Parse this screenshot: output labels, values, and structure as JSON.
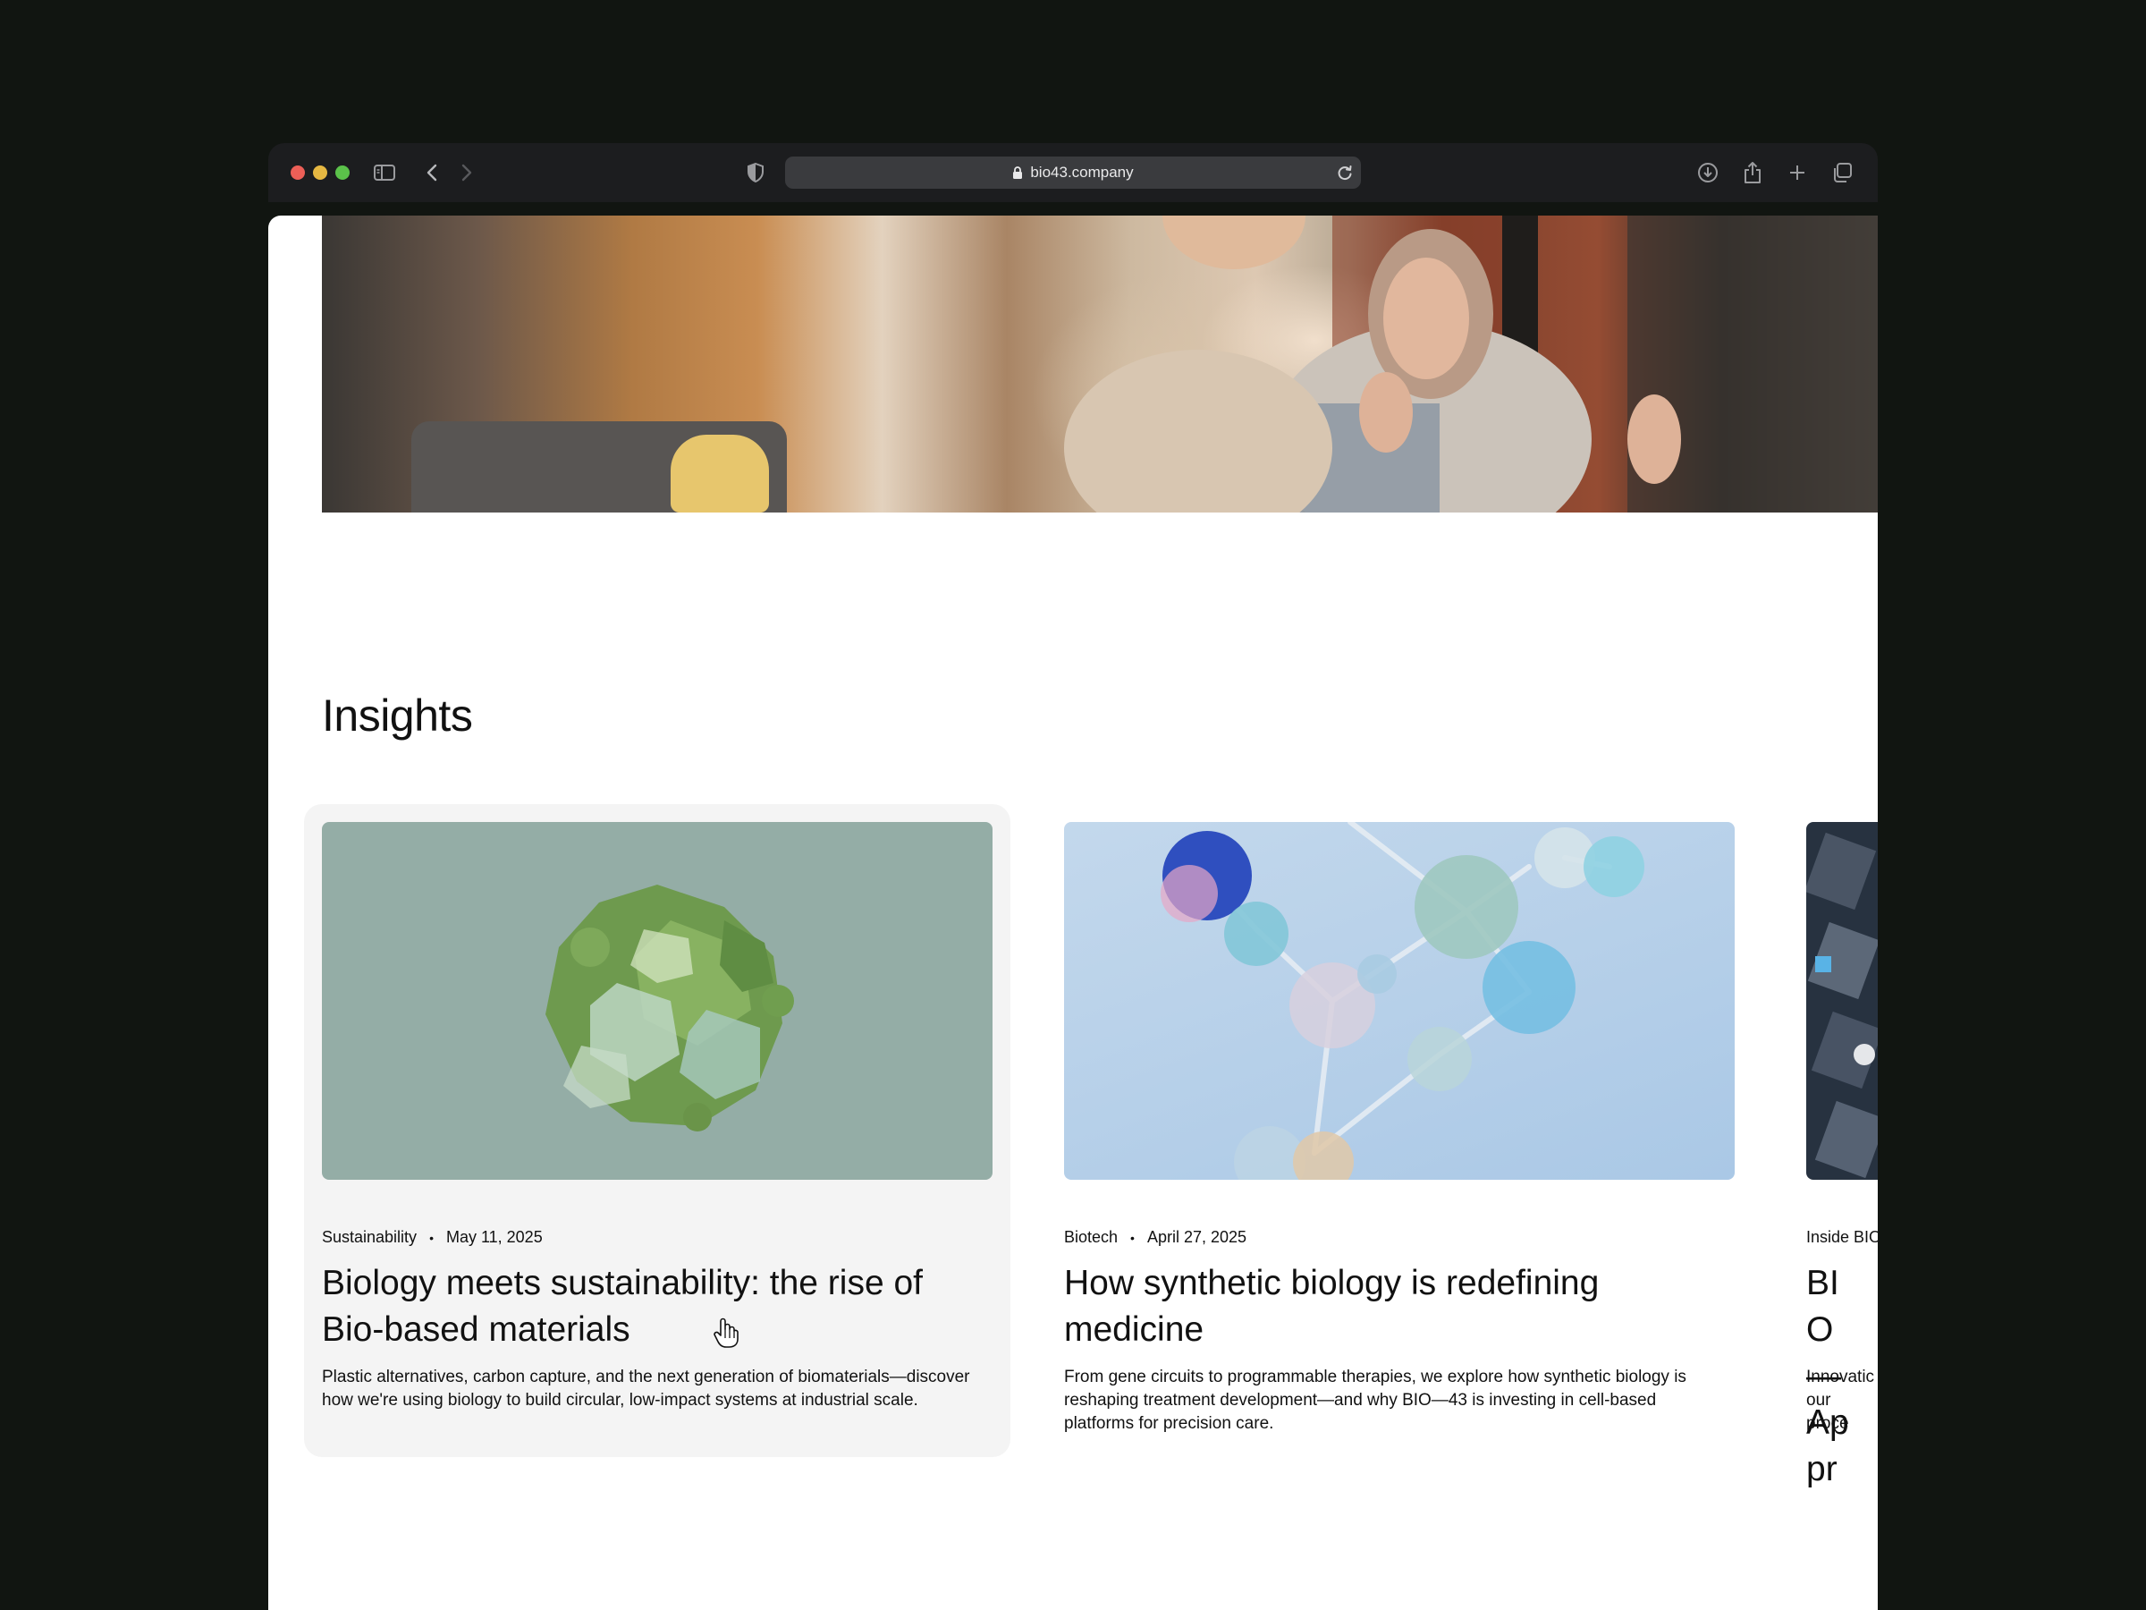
{
  "browser": {
    "url": "bio43.company"
  },
  "insights": {
    "title": "Insights",
    "cards": [
      {
        "category": "Sustainability",
        "date": "May 11, 2025",
        "title": "Biology meets sustainability: the rise of Bio-based materials",
        "excerpt": "Plastic alternatives, carbon capture, and the next generation of biomaterials—discover how we're using biology to build circular, low-impact systems at industrial scale."
      },
      {
        "category": "Biotech",
        "date": "April 27, 2025",
        "title": "How synthetic biology is redefining medicine",
        "excerpt": "From gene circuits to programmable therapies, we explore how synthetic biology is reshaping treatment development—and why BIO—43 is investing in cell-based platforms for precision care."
      },
      {
        "category": "Inside BIO",
        "title": "BIO—Appr",
        "excerpt": "Innovatic our proce"
      }
    ]
  },
  "colors": {
    "page_bg": "#111511",
    "card_hover_bg": "#f4f4f4",
    "image1_bg": "#94ada6",
    "image2_bg": "#b7d0e6"
  }
}
